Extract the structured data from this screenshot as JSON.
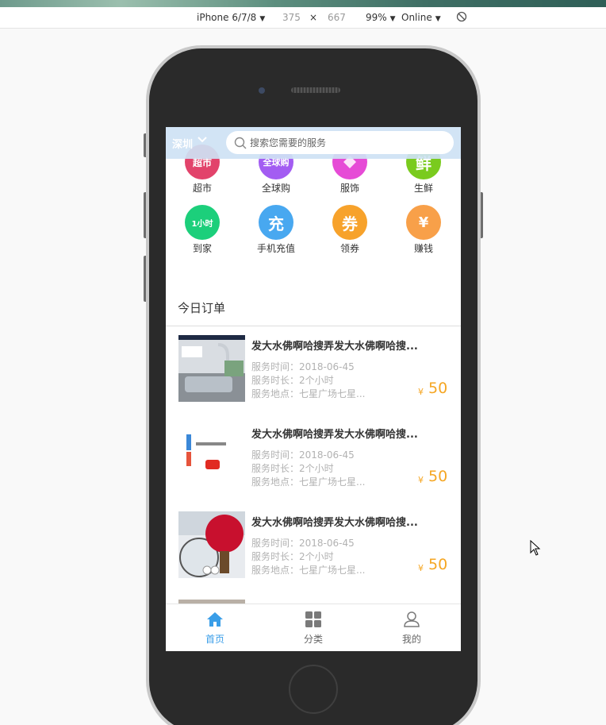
{
  "devtools": {
    "device": "iPhone 6/7/8",
    "width": "375",
    "times": "×",
    "height": "667",
    "zoom": "99%",
    "network": "Online"
  },
  "header": {
    "city": "深圳",
    "search_placeholder": "搜索您需要的服务"
  },
  "categories": [
    {
      "label": "超市",
      "icon_text": "超市",
      "color": "#e2436b"
    },
    {
      "label": "全球购",
      "icon_text": "全球购",
      "color": "#a35cf2"
    },
    {
      "label": "服饰",
      "icon_text": "",
      "color": "#e64bd6"
    },
    {
      "label": "生鲜",
      "icon_text": "鲜",
      "color": "#7acb1e"
    },
    {
      "label": "到家",
      "icon_text": "1小时",
      "color": "#1ccf7b"
    },
    {
      "label": "手机充值",
      "icon_text": "充",
      "color": "#48a8f0"
    },
    {
      "label": "领券",
      "icon_text": "券",
      "color": "#f7a22b"
    },
    {
      "label": "赚钱",
      "icon_text": "¥",
      "color": "#f8a049"
    }
  ],
  "today": {
    "title": "今日订单"
  },
  "orders": [
    {
      "title": "发大水佛啊哈搜弄发大水佛啊哈搜...",
      "time": "服务时间：2018-06-45",
      "duration": "服务时长：2个小时",
      "location": "服务地点：七星广场七星...",
      "currency": "¥",
      "price": "50",
      "thumb": "faucet"
    },
    {
      "title": "发大水佛啊哈搜弄发大水佛啊哈搜...",
      "time": "服务时间：2018-06-45",
      "duration": "服务时长：2个小时",
      "location": "服务地点：七星广场七星...",
      "currency": "¥",
      "price": "50",
      "thumb": "sticker"
    },
    {
      "title": "发大水佛啊哈搜弄发大水佛啊哈搜...",
      "time": "服务时间：2018-06-45",
      "duration": "服务时长：2个小时",
      "location": "服务地点：七星广场七星...",
      "currency": "¥",
      "price": "50",
      "thumb": "paddle"
    }
  ],
  "tabbar": {
    "active_color": "#3a9ee8",
    "inactive_color": "#666666",
    "items": [
      {
        "label": "首页",
        "icon": "home-icon"
      },
      {
        "label": "分类",
        "icon": "grid-icon"
      },
      {
        "label": "我的",
        "icon": "user-icon"
      }
    ]
  }
}
